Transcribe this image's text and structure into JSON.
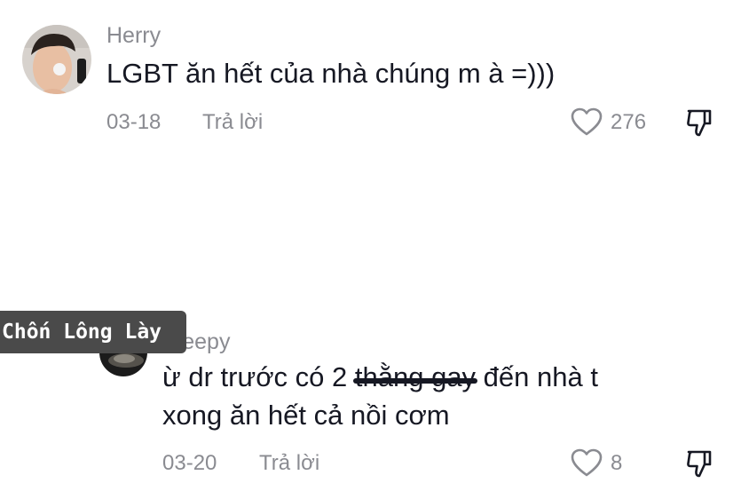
{
  "comments": [
    {
      "username": "Herry",
      "text": "LGBT ăn hết của nhà chúng m à =)))",
      "date": "03-18",
      "reply_label": "Trả lời",
      "like_count": "276"
    },
    {
      "username": "Sleepy",
      "text_before": "ừ dr trước có 2 ",
      "text_struck": "thằng gay",
      "text_after": " đến nhà t",
      "text_line2": "xong ăn hết cả nồi cơm",
      "date": "03-20",
      "reply_label": "Trả lời",
      "like_count": "8"
    }
  ],
  "watermark": "Chốn Lông Lày",
  "icons": [
    "heart-icon",
    "dislike-icon"
  ]
}
